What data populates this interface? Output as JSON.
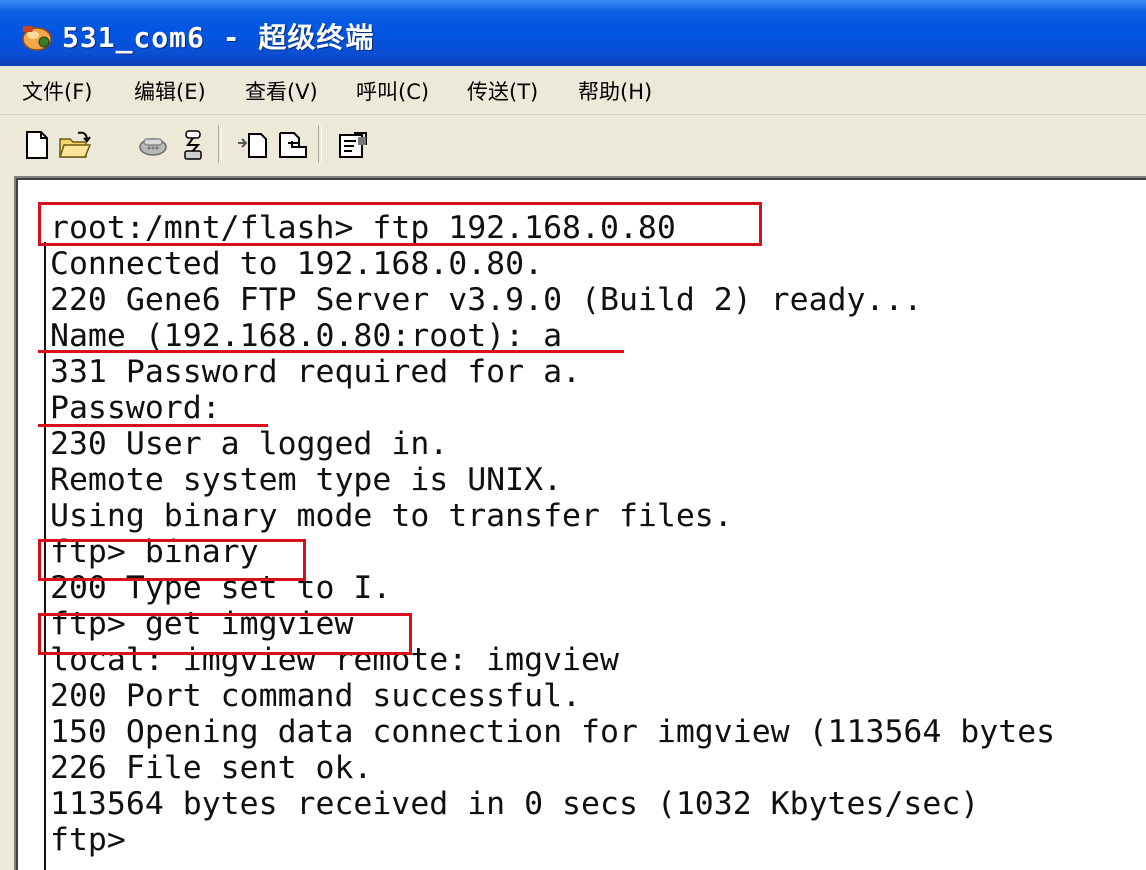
{
  "window": {
    "title": "531_com6 - 超级终端",
    "icon": "hyperterminal-phone-icon"
  },
  "menu": [
    {
      "label": "文件(F)"
    },
    {
      "label": "编辑(E)"
    },
    {
      "label": "查看(V)"
    },
    {
      "label": "呼叫(C)"
    },
    {
      "label": "传送(T)"
    },
    {
      "label": "帮助(H)"
    }
  ],
  "toolbar": [
    {
      "icon": "new-document-icon"
    },
    {
      "icon": "open-folder-icon"
    },
    {
      "icon": "connect-icon"
    },
    {
      "icon": "disconnect-icon"
    },
    {
      "icon": "send-file-icon"
    },
    {
      "icon": "receive-file-icon"
    },
    {
      "icon": "properties-icon"
    }
  ],
  "terminal": {
    "lines": [
      "root:/mnt/flash> ftp 192.168.0.80",
      "Connected to 192.168.0.80.",
      "220 Gene6 FTP Server v3.9.0 (Build 2) ready...",
      "Name (192.168.0.80:root): a",
      "331 Password required for a.",
      "Password:",
      "230 User a logged in.",
      "Remote system type is UNIX.",
      "Using binary mode to transfer files.",
      "ftp> binary",
      "200 Type set to I.",
      "ftp> get imgview",
      "local: imgview remote: imgview",
      "200 Port command successful.",
      "150 Opening data connection for imgview (113564 bytes",
      "226 File sent ok.",
      "113564 bytes received in 0 secs (1032 Kbytes/sec)",
      "ftp>"
    ]
  },
  "colors": {
    "titlebar": "#0054e3",
    "annotation": "#d9101a",
    "terminal_bg": "#ffffff",
    "terminal_text": "#101010"
  }
}
